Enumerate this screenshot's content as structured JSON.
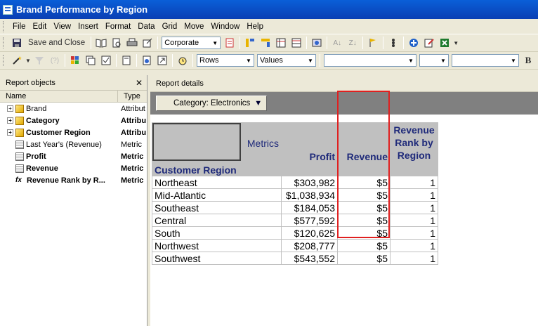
{
  "window": {
    "title": "Brand Performance by Region"
  },
  "menu": [
    "File",
    "Edit",
    "View",
    "Insert",
    "Format",
    "Data",
    "Grid",
    "Move",
    "Window",
    "Help"
  ],
  "toolbar1": {
    "save_close_label": "Save and Close",
    "style_combo": "Corporate"
  },
  "toolbar2": {
    "rows_combo": "Rows",
    "values_combo": "Values",
    "bold_label": "B"
  },
  "left_panel": {
    "title": "Report objects",
    "columns": {
      "name": "Name",
      "type": "Type"
    },
    "items": [
      {
        "name": "Brand",
        "type": "Attribut"
      },
      {
        "name": "Category",
        "type": "Attribu"
      },
      {
        "name": "Customer Region",
        "type": "Attribu"
      },
      {
        "name": "Last Year's (Revenue)",
        "type": "Metric"
      },
      {
        "name": "Profit",
        "type": "Metric"
      },
      {
        "name": "Revenue",
        "type": "Metric"
      },
      {
        "name": "Revenue Rank by R...",
        "type": "Metric"
      }
    ]
  },
  "right_panel": {
    "title": "Report details",
    "page_by": "Category: Electronics",
    "grid": {
      "metrics_label": "Metrics",
      "row_header": "Customer Region",
      "columns": [
        "Profit",
        "Revenue",
        "Revenue Rank by Region"
      ],
      "col_rank_lines": [
        "Revenue",
        "Rank by",
        "Region"
      ],
      "rows": [
        {
          "region": "Northeast",
          "profit": "$303,982",
          "revenue": "$5",
          "rank": "1"
        },
        {
          "region": "Mid-Atlantic",
          "profit": "$1,038,934",
          "revenue": "$5",
          "rank": "1"
        },
        {
          "region": "Southeast",
          "profit": "$184,053",
          "revenue": "$5",
          "rank": "1"
        },
        {
          "region": "Central",
          "profit": "$577,592",
          "revenue": "$5",
          "rank": "1"
        },
        {
          "region": "South",
          "profit": "$120,625",
          "revenue": "$5",
          "rank": "1"
        },
        {
          "region": "Northwest",
          "profit": "$208,777",
          "revenue": "$5",
          "rank": "1"
        },
        {
          "region": "Southwest",
          "profit": "$543,552",
          "revenue": "$5",
          "rank": "1"
        }
      ]
    }
  },
  "colors": {
    "highlight": "#e02020",
    "header_text": "#1f2a7a",
    "header_bg": "#c0c0c0"
  }
}
